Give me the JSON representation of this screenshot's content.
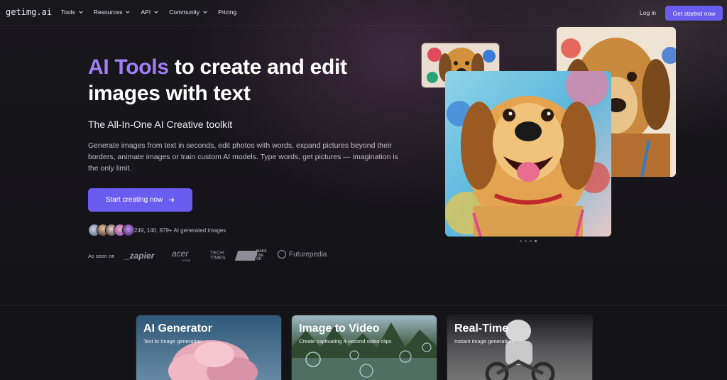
{
  "nav": {
    "logo": "getimg.ai",
    "links": [
      {
        "label": "Tools",
        "dropdown": true
      },
      {
        "label": "Resources",
        "dropdown": true
      },
      {
        "label": "API",
        "dropdown": true
      },
      {
        "label": "Community",
        "dropdown": true
      },
      {
        "label": "Pricing",
        "dropdown": false
      }
    ],
    "login": "Log in",
    "cta": "Get started now"
  },
  "hero": {
    "title_accent": "AI Tools",
    "title_rest": " to create and edit images with text",
    "subtitle": "The All-In-One AI Creative toolkit",
    "description": "Generate images from text in seconds, edit photos with words, expand pictures beyond their borders, animate images or train custom AI models. Type words, get pictures — imagination is the only limit.",
    "cta": "Start creating now",
    "cta_icon": "arrow-right-icon",
    "stats": "249, 140, 879+ AI generated images",
    "as_seen_on": "As seen on",
    "brands": {
      "zapier": "_zapier",
      "acer": "acer",
      "acer_sub": "corner",
      "techtimes": "TECH TIMES",
      "muo": "MAKE USE OF.",
      "futurepedia": "Futurepedia"
    }
  },
  "carousel": {
    "dots": 4,
    "active_index": 3
  },
  "cards": [
    {
      "title": "AI Generator",
      "subtitle": "Text to Image generation"
    },
    {
      "title": "Image to Video",
      "subtitle": "Create captivating 4-second video clips"
    },
    {
      "title": "Real-Time",
      "subtitle": "Instant image generation"
    }
  ],
  "colors": {
    "accent": "#6b5cf0",
    "title_accent": "#a27ef7",
    "background": "#141318"
  }
}
